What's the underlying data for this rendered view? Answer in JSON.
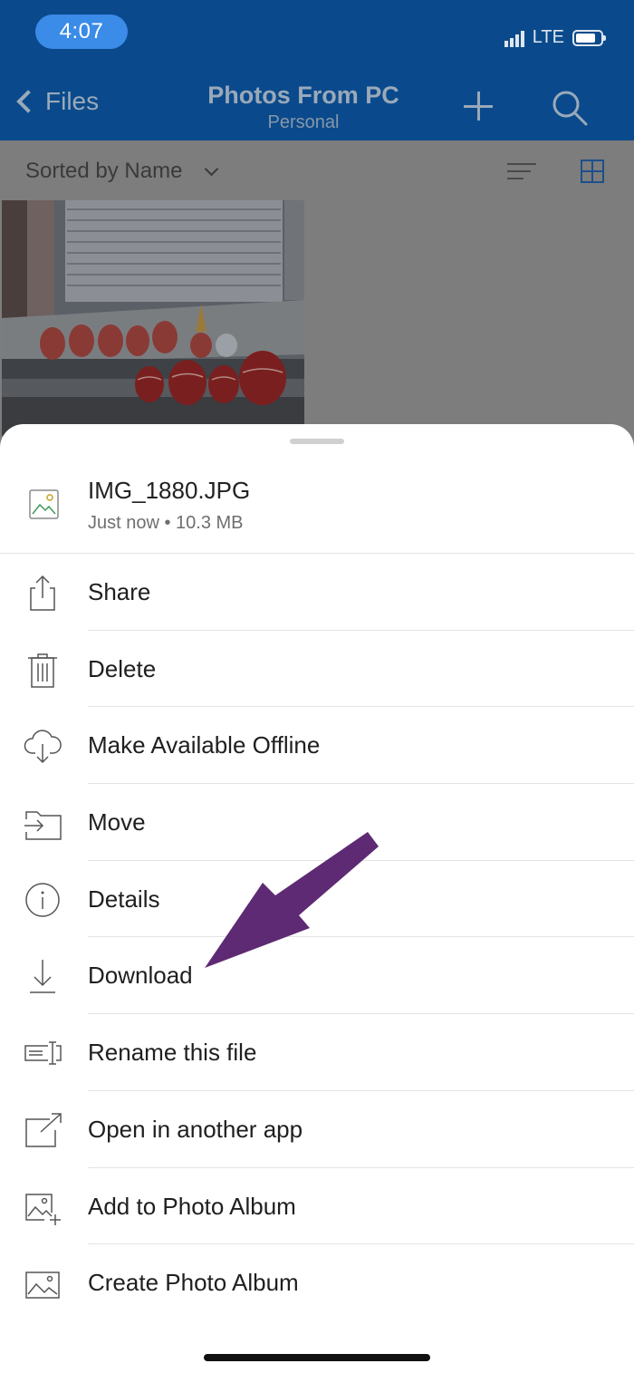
{
  "status_bar": {
    "time": "4:07",
    "network": "LTE"
  },
  "nav": {
    "back_label": "Files",
    "title": "Photos From PC",
    "subtitle": "Personal"
  },
  "sort": {
    "label": "Sorted by Name"
  },
  "file": {
    "name": "IMG_1880.JPG",
    "meta": "Just now • 10.3 MB"
  },
  "menu": [
    {
      "label": "Share",
      "icon": "share-icon"
    },
    {
      "label": "Delete",
      "icon": "trash-icon"
    },
    {
      "label": "Make Available Offline",
      "icon": "cloud-download-icon"
    },
    {
      "label": "Move",
      "icon": "move-folder-icon"
    },
    {
      "label": "Details",
      "icon": "info-icon"
    },
    {
      "label": "Download",
      "icon": "download-icon"
    },
    {
      "label": "Rename this file",
      "icon": "rename-icon"
    },
    {
      "label": "Open in another app",
      "icon": "open-external-icon"
    },
    {
      "label": "Add to Photo Album",
      "icon": "add-photo-icon"
    },
    {
      "label": "Create Photo Album",
      "icon": "photo-album-icon"
    }
  ],
  "colors": {
    "nav_bar": "#0a4a8c",
    "time_pill": "#3b8be8",
    "annotation_arrow": "#5e2a73"
  }
}
